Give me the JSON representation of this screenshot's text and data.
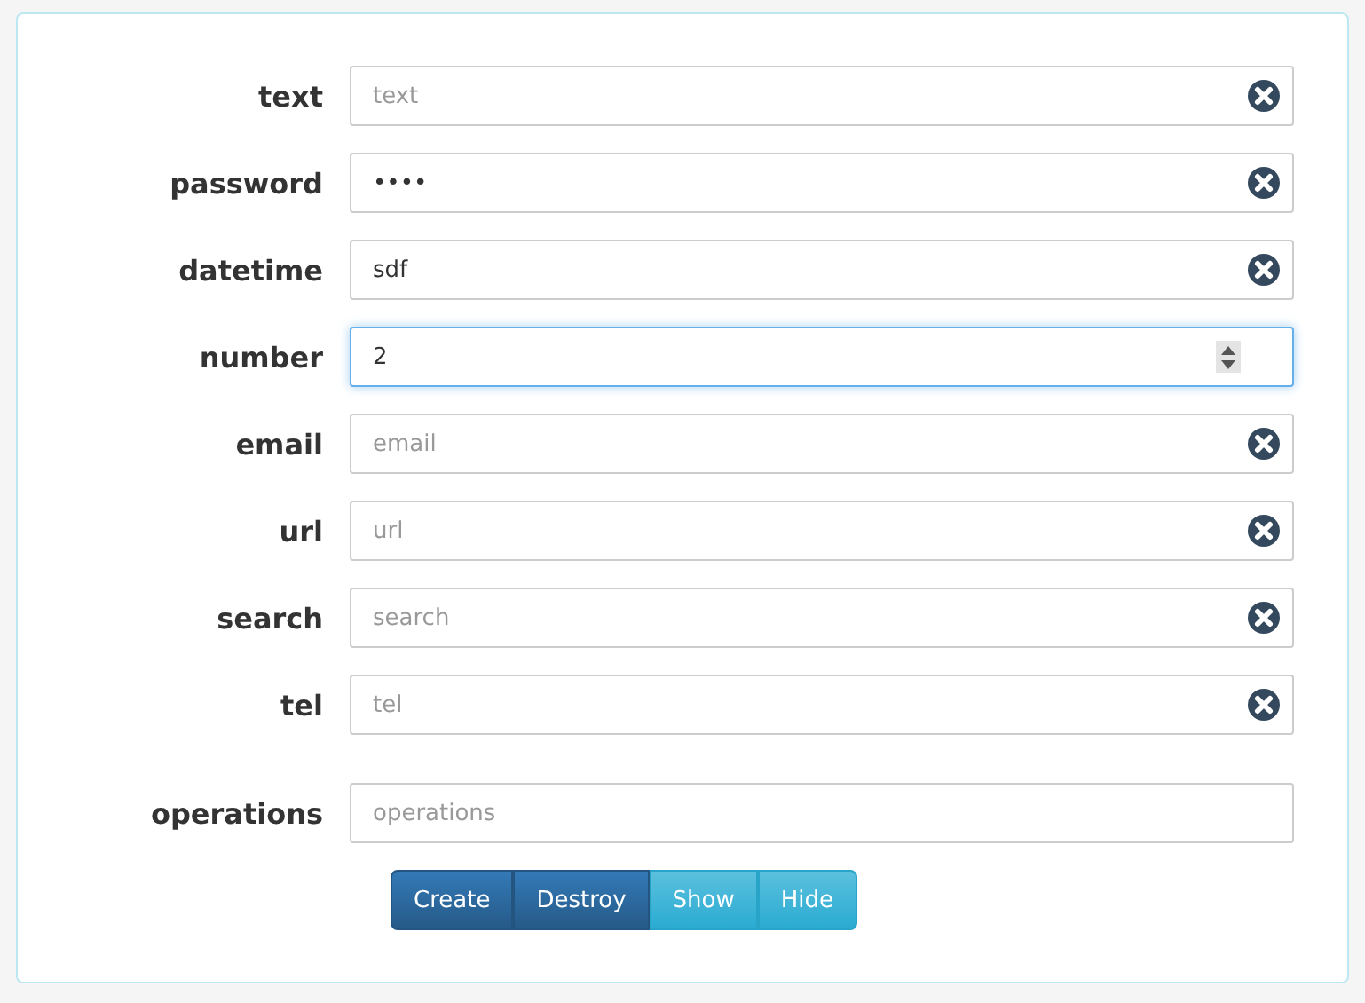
{
  "fields": [
    {
      "label": "text",
      "kind": "clearable",
      "placeholder": "text",
      "focused": false
    },
    {
      "label": "password",
      "kind": "clearable",
      "value": "••••",
      "focused": false
    },
    {
      "label": "datetime",
      "kind": "clearable",
      "value": "sdf",
      "focused": false
    },
    {
      "label": "number",
      "kind": "number",
      "value": "2",
      "focused": true
    },
    {
      "label": "email",
      "kind": "clearable",
      "placeholder": "email",
      "focused": false
    },
    {
      "label": "url",
      "kind": "clearable",
      "placeholder": "url",
      "focused": false
    },
    {
      "label": "search",
      "kind": "clearable",
      "placeholder": "search",
      "focused": false
    },
    {
      "label": "tel",
      "kind": "clearable",
      "placeholder": "tel",
      "focused": false
    }
  ],
  "operations": {
    "label": "operations",
    "placeholder": "operations"
  },
  "buttons": [
    {
      "label": "Create",
      "kind": "primary"
    },
    {
      "label": "Destroy",
      "kind": "primary"
    },
    {
      "label": "Show",
      "kind": "info"
    },
    {
      "label": "Hide",
      "kind": "info"
    }
  ]
}
